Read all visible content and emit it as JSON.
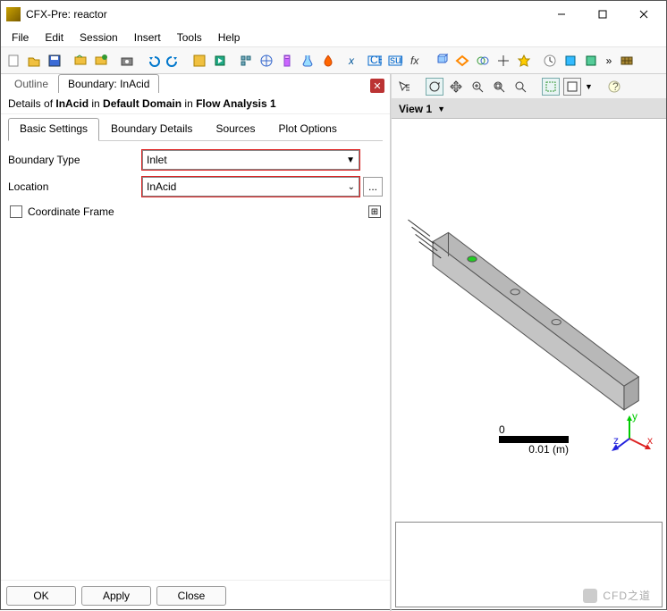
{
  "window": {
    "title": "CFX-Pre:  reactor",
    "minimize": "–",
    "maximize": "▢",
    "close": "✕"
  },
  "menu": {
    "file": "File",
    "edit": "Edit",
    "session": "Session",
    "insert": "Insert",
    "tools": "Tools",
    "help": "Help"
  },
  "tabs": {
    "outline": "Outline",
    "boundary": "Boundary: InAcid"
  },
  "details": {
    "prefix": "Details of ",
    "item": "InAcid",
    "mid1": " in ",
    "domain": "Default Domain",
    "mid2": " in ",
    "analysis": "Flow Analysis 1"
  },
  "subtabs": {
    "basic": "Basic Settings",
    "bdetails": "Boundary Details",
    "sources": "Sources",
    "plot": "Plot Options"
  },
  "form": {
    "btype_label": "Boundary Type",
    "btype_value": "Inlet",
    "loc_label": "Location",
    "loc_value": "InAcid",
    "loc_more": "...",
    "coord_label": "Coordinate Frame"
  },
  "buttons": {
    "ok": "OK",
    "apply": "Apply",
    "close": "Close"
  },
  "viewport": {
    "view_label": "View 1",
    "scale_zero": "0",
    "scale_value": "0.01",
    "scale_unit": "(m)",
    "axis_x": "x",
    "axis_y": "y",
    "axis_z": "z"
  },
  "watermark": "CFD之道"
}
